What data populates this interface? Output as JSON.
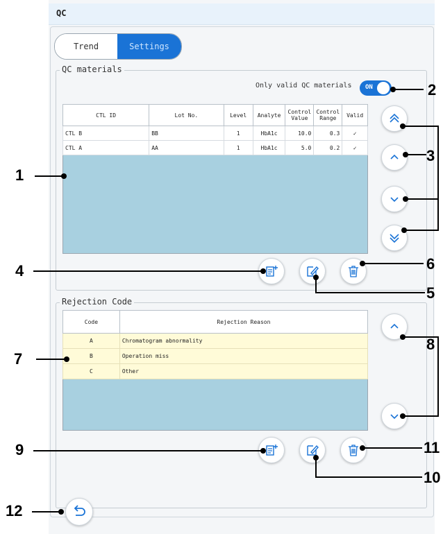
{
  "window": {
    "title": "QC"
  },
  "tabs": [
    {
      "label": "Trend"
    },
    {
      "label": "Settings"
    }
  ],
  "qc_materials": {
    "legend": "QC materials",
    "only_valid_label": "Only valid QC materials",
    "toggle": "ON",
    "columns": [
      "CTL ID",
      "Lot No.",
      "Level",
      "Analyte",
      "Control Value",
      "Control Range",
      "Valid"
    ],
    "rows": [
      [
        "CTL B",
        "BB",
        "1",
        "HbA1c",
        "10.0",
        "0.3",
        "✓"
      ],
      [
        "CTL A",
        "AA",
        "1",
        "HbA1c",
        "5.0",
        "0.2",
        "✓"
      ]
    ]
  },
  "rejection_code": {
    "legend": "Rejection Code",
    "columns": [
      "Code",
      "Rejection Reason"
    ],
    "rows": [
      [
        "A",
        "Chromatogram abnormality"
      ],
      [
        "B",
        "Operation miss"
      ],
      [
        "C",
        "Other"
      ]
    ]
  },
  "callouts": [
    "1",
    "2",
    "3",
    "4",
    "5",
    "6",
    "7",
    "8",
    "9",
    "10",
    "11",
    "12"
  ],
  "icons": {
    "scroll_top": "double-chevron-up-icon",
    "scroll_up": "chevron-up-icon",
    "scroll_down": "chevron-down-icon",
    "scroll_bottom": "double-chevron-down-icon",
    "add": "add-list-icon",
    "edit": "edit-icon",
    "delete": "trash-icon",
    "back": "back-arrow-icon"
  },
  "colors": {
    "accent": "#1a73d6",
    "table_empty": "#a8d0e0",
    "code_row": "#fffbd8"
  }
}
